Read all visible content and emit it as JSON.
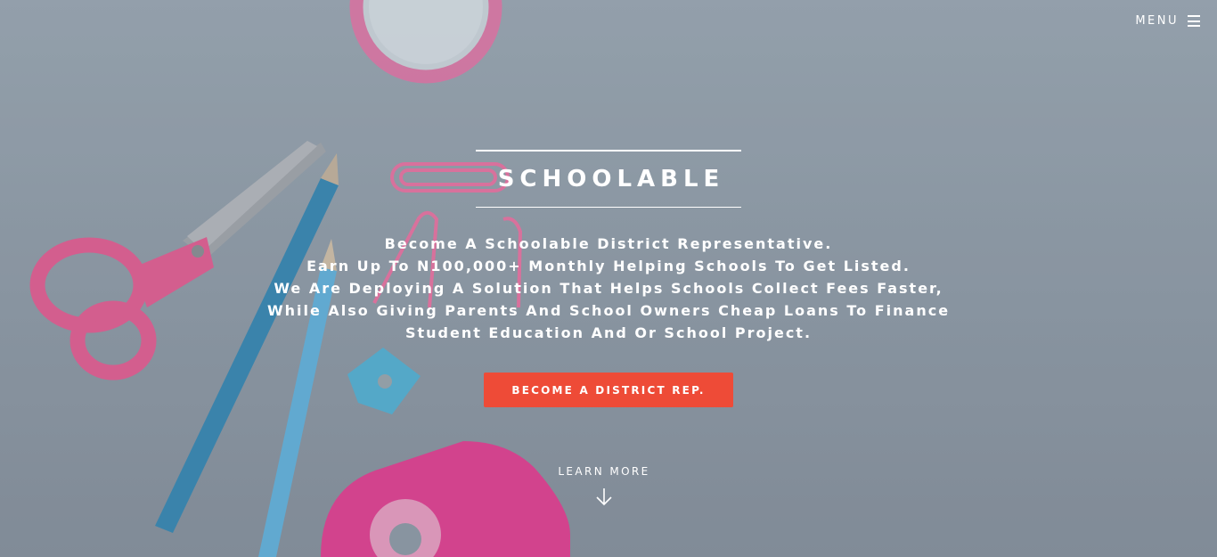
{
  "nav": {
    "menu_label": "MENU",
    "menu_icon": "hamburger-icon"
  },
  "hero": {
    "title": "SCHOOLABLE",
    "tagline_lines": [
      "Become A Schoolable District Representative.",
      "Earn Up To N100,000+ Monthly Helping Schools To Get Listed.",
      "We Are Deploying A Solution That Helps Schools Collect Fees Faster,",
      "While Also Giving Parents And School Owners Cheap Loans To Finance",
      "Student Education And Or School Project."
    ],
    "cta_label": "BECOME A DISTRICT REP.",
    "learn_more_label": "LEARN MORE",
    "learn_more_icon": "arrow-down-icon"
  },
  "colors": {
    "cta": "#ee4b37",
    "text": "#ffffff",
    "background": "#8f9ba6"
  }
}
